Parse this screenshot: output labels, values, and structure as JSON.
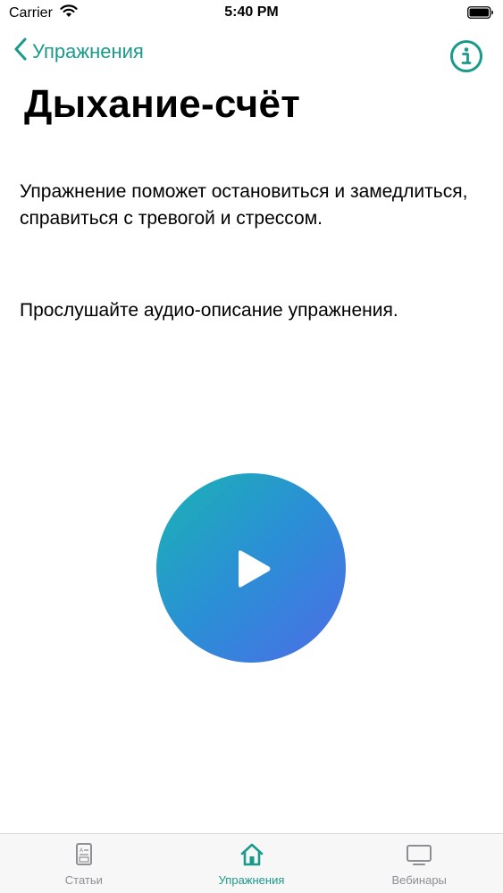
{
  "status_bar": {
    "carrier": "Carrier",
    "time": "5:40 PM"
  },
  "nav": {
    "back_label": "Упражнения",
    "info_icon": "info-icon"
  },
  "page": {
    "title": "Дыхание-счёт",
    "description": "Упражнение поможет остановиться и замедлиться, справиться с тревогой и стрессом.",
    "instruction": "Прослушайте аудио-описание упражнения."
  },
  "player": {
    "icon": "play-icon"
  },
  "tab_bar": {
    "tabs": [
      {
        "label": "Статьи",
        "icon": "articles-icon",
        "active": false
      },
      {
        "label": "Упражнения",
        "icon": "home-icon",
        "active": true
      },
      {
        "label": "Вебинары",
        "icon": "tv-icon",
        "active": false
      }
    ]
  },
  "colors": {
    "accent": "#1a9a8a",
    "gradient_start": "#1bb3b3",
    "gradient_end": "#4d6ce6",
    "tab_inactive": "#8e8e93"
  }
}
